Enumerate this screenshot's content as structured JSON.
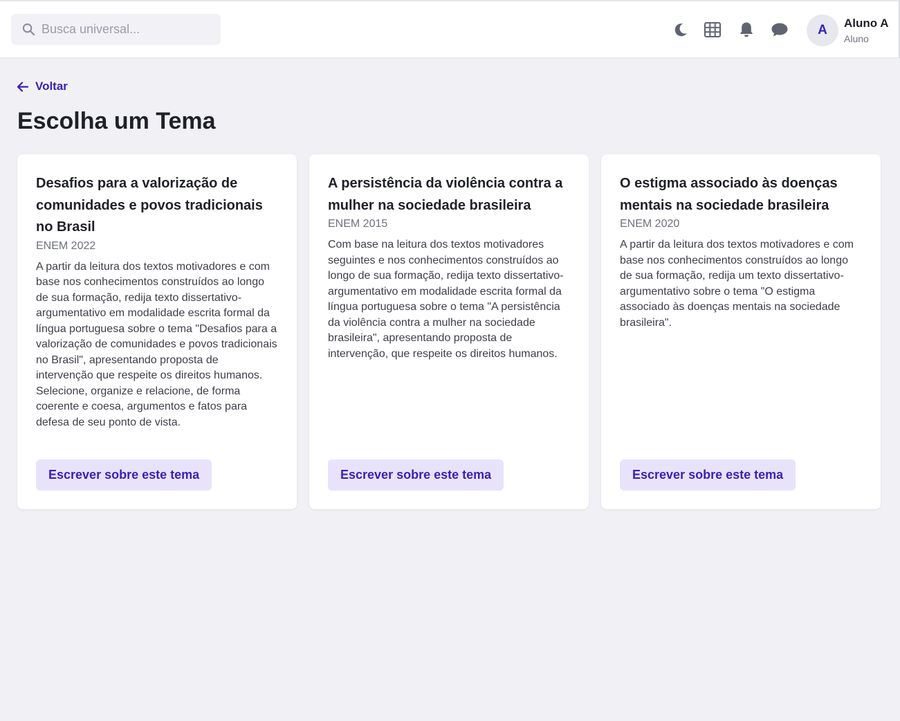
{
  "header": {
    "search": {
      "placeholder": "Busca universal..."
    },
    "user": {
      "initial": "A",
      "name": "Aluno A",
      "role": "Aluno"
    },
    "icons": [
      "moon-icon",
      "grid-icon",
      "bell-icon",
      "chat-icon"
    ]
  },
  "nav": {
    "back_label": "Voltar"
  },
  "page": {
    "title": "Escolha um Tema"
  },
  "themes": [
    {
      "title": "Desafios para a valorização de comunidades e povos tradicionais no Brasil",
      "exam": "ENEM 2022",
      "description": "A partir da leitura dos textos motivadores e com base nos conhecimentos construídos ao longo de sua formação, redija texto dissertativo-argumentativo em modalidade escrita formal da língua portuguesa sobre o tema \"Desafios para a valorização de comunidades e povos tradicionais no Brasil\", apresentando proposta de intervenção que respeite os direitos humanos. Selecione, organize e relacione, de forma coerente e coesa, argumentos e fatos para defesa de seu ponto de vista.",
      "button_label": "Escrever sobre este tema"
    },
    {
      "title": "A persistência da violência contra a mulher na sociedade brasileira",
      "exam": "ENEM 2015",
      "description": "Com base na leitura dos textos motivadores seguintes e nos conhecimentos construídos ao longo de sua formação, redija texto dissertativo-argumentativo em modalidade escrita formal da língua portuguesa sobre o tema \"A persistência da violência contra a mulher na sociedade brasileira\", apresentando proposta de intervenção, que respeite os direitos humanos.",
      "button_label": "Escrever sobre este tema"
    },
    {
      "title": "O estigma associado às doenças mentais na sociedade brasileira",
      "exam": "ENEM 2020",
      "description": "A partir da leitura dos textos motivadores e com base nos conhecimentos construídos ao longo de sua formação, redija um texto dissertativo-argumentativo sobre o tema \"O estigma associado às doenças mentais na sociedade brasileira\".",
      "button_label": "Escrever sobre este tema"
    }
  ],
  "colors": {
    "accent": "#3b1fb8",
    "accent_bg": "#e8e3fb",
    "page_bg": "#f1f1f5",
    "icon": "#5f6370"
  }
}
